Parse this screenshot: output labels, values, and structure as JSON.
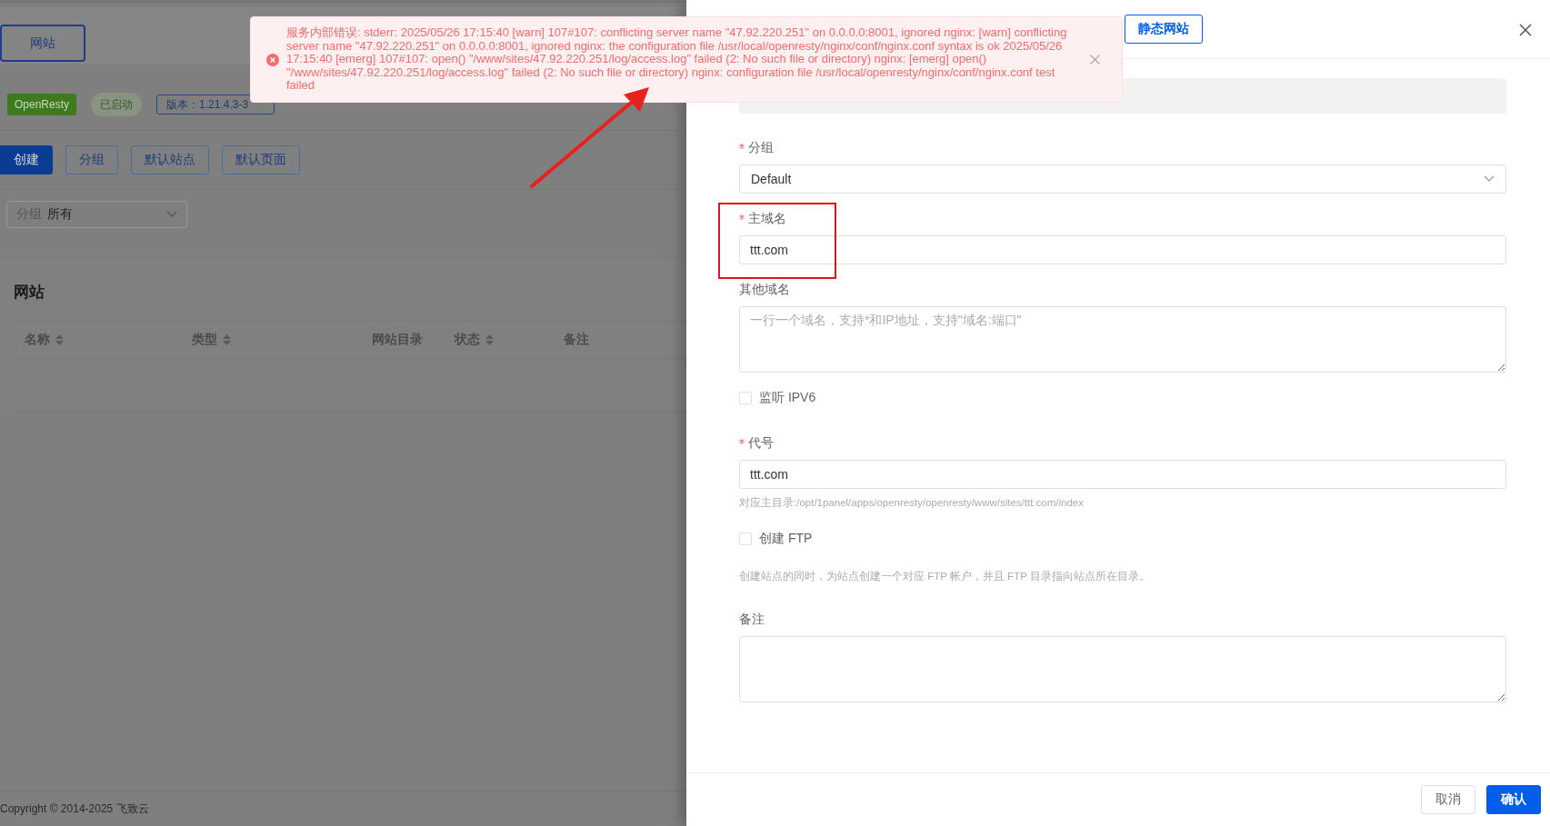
{
  "page_tab": {
    "label": "网站",
    "selected": true
  },
  "app_tags": [
    {
      "kind": "name",
      "text": "OpenResty"
    },
    {
      "kind": "status",
      "text": "已启动"
    },
    {
      "kind": "version",
      "text": "版本：1.21.4.3-3"
    }
  ],
  "toolbar_buttons": [
    {
      "kind": "primary",
      "label": "创建"
    },
    {
      "kind": "plain",
      "label": "分组"
    },
    {
      "kind": "plain",
      "label": "默认站点"
    },
    {
      "kind": "plain",
      "label": "默认页面"
    }
  ],
  "group_filter": {
    "label": "分组",
    "value": "所有"
  },
  "card_title": "网站",
  "table": {
    "columns": [
      {
        "label": "名称",
        "sortable": true
      },
      {
        "label": "类型",
        "sortable": true
      },
      {
        "label": "网站目录",
        "sortable": false
      },
      {
        "label": "状态",
        "sortable": true
      },
      {
        "label": "备注",
        "sortable": false
      }
    ]
  },
  "footer": "Copyright © 2014-2025 飞致云",
  "error_message": {
    "text": "服务内部错误: stderr: 2025/05/26 17:15:40 [warn] 107#107: conflicting server name \"47.92.220.251\" on 0.0.0.0:8001, ignored nginx: [warn] conflicting server name \"47.92.220.251\" on 0.0.0.0:8001, ignored nginx: the configuration file /usr/local/openresty/nginx/conf/nginx.conf syntax is ok 2025/05/26 17:15:40 [emerg] 107#107: open() \"/www/sites/47.92.220.251/log/access.log\" failed (2: No such file or directory) nginx: [emerg] open() \"/www/sites/47.92.220.251/log/access.log\" failed (2: No such file or directory) nginx: configuration file /usr/local/openresty/nginx/conf/nginx.conf test failed"
  },
  "drawer": {
    "type_tab": {
      "label": "静态网站",
      "selected": true
    },
    "fields": [
      {
        "kind": "disabled"
      },
      {
        "kind": "select",
        "label": "分组",
        "required": true,
        "value": "Default"
      },
      {
        "kind": "input",
        "label": "主域名",
        "required": true,
        "value": "ttt.com",
        "highlighted": true
      },
      {
        "kind": "textarea",
        "label": "其他域名",
        "required": false,
        "placeholder": "一行一个域名，支持*和IP地址，支持\"域名:端口\""
      },
      {
        "kind": "checkbox",
        "label": "监听 IPV6",
        "checked": false
      },
      {
        "kind": "input",
        "label": "代号",
        "required": true,
        "value": "ttt.com",
        "hint": "对应主目录:/opt/1panel/apps/openresty/openresty/www/sites/ttt.com/index"
      },
      {
        "kind": "checkbox",
        "label": "创建 FTP",
        "checked": false,
        "hint": "创建站点的同时，为站点创建一个对应 FTP 帐户，并且 FTP 目录指向站点所在目录。"
      },
      {
        "kind": "textarea",
        "label": "备注",
        "required": false
      }
    ],
    "buttons": [
      {
        "kind": "plain",
        "label": "取消"
      },
      {
        "kind": "primary",
        "label": "确认"
      }
    ]
  }
}
